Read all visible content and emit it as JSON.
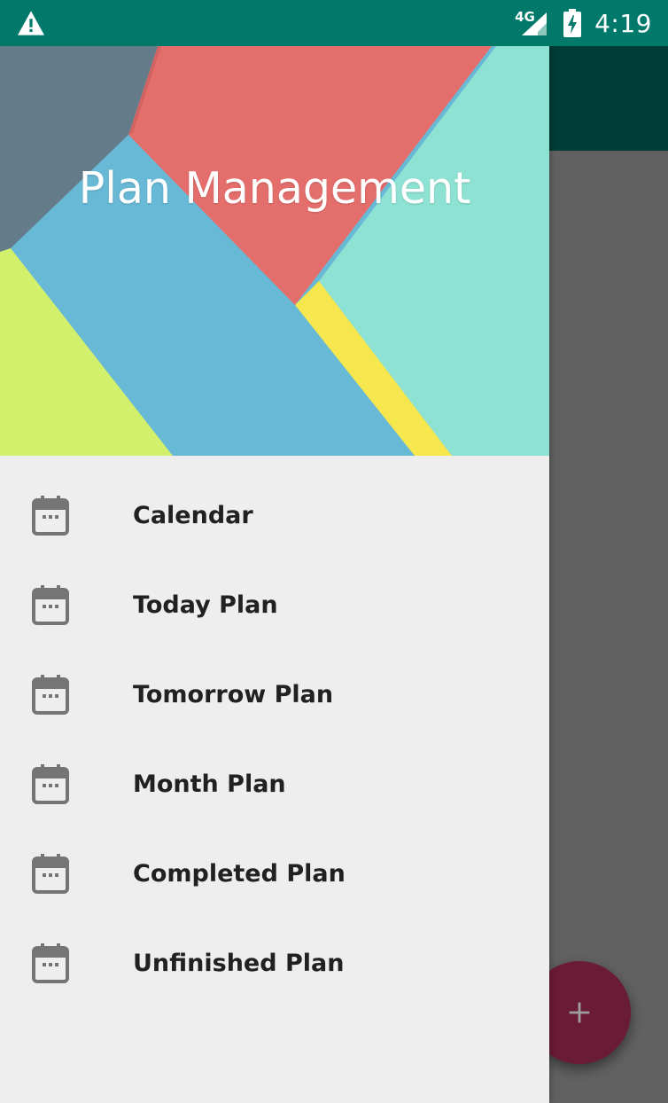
{
  "status_bar": {
    "network": "4G",
    "time": "4:19",
    "icons": [
      "warning-icon",
      "signal-icon",
      "battery-charging-icon"
    ]
  },
  "drawer": {
    "title": "Plan Management",
    "items": [
      {
        "label": "Calendar",
        "icon": "calendar-icon"
      },
      {
        "label": "Today Plan",
        "icon": "calendar-icon"
      },
      {
        "label": "Tomorrow Plan",
        "icon": "calendar-icon"
      },
      {
        "label": "Month Plan",
        "icon": "calendar-icon"
      },
      {
        "label": "Completed Plan",
        "icon": "calendar-icon"
      },
      {
        "label": "Unfinished Plan",
        "icon": "calendar-icon"
      }
    ]
  },
  "fab": {
    "icon": "plus-icon"
  },
  "colors": {
    "status_bar": "#00796b",
    "toolbar": "#003d36",
    "scrim": "#616161",
    "drawer_bg": "#eeeeee",
    "fab": "#6a1b35"
  }
}
